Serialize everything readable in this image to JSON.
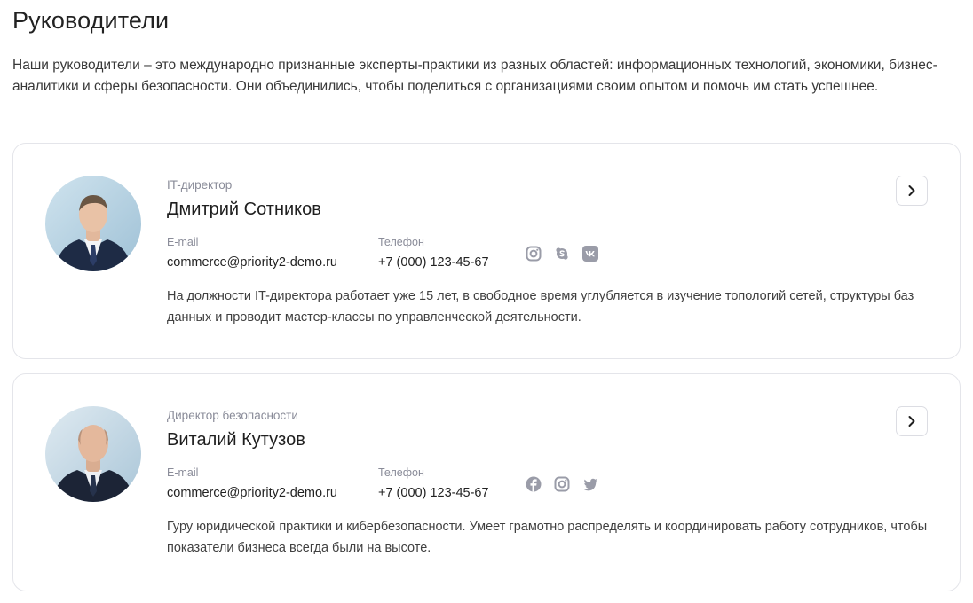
{
  "page": {
    "title": "Руководители",
    "intro": "Наши руководители – это международно признанные эксперты-практики из разных областей: информационных технологий, экономики, бизнес-аналитики и сферы безопасности. Они объединились, чтобы поделиться с организациями своим опытом и помочь им стать успешнее."
  },
  "labels": {
    "email": "E-mail",
    "phone": "Телефон"
  },
  "managers": [
    {
      "role": "IT-директор",
      "name": "Дмитрий Сотников",
      "email": "commerce@priority2-demo.ru",
      "phone": "+7 (000) 123-45-67",
      "socials": [
        "instagram-icon",
        "skype-icon",
        "vk-icon"
      ],
      "description": "На должности IT-директора работает уже 15 лет, в свободное время углубляется в изучение топологий сетей, структуры баз данных и проводит мастер-классы по управленческой деятельности."
    },
    {
      "role": "Директор безопасности",
      "name": "Виталий Кутузов",
      "email": "commerce@priority2-demo.ru",
      "phone": "+7 (000) 123-45-67",
      "socials": [
        "facebook-icon",
        "instagram-icon",
        "twitter-icon"
      ],
      "description": "Гуру юридической практики и кибербезопасности. Умеет грамотно распределять и координировать работу сотрудников, чтобы показатели бизнеса всегда были на высоте."
    }
  ],
  "colors": {
    "icon_gray": "#9a9ca8",
    "border": "#e4e5ea",
    "muted_text": "#8a8c99"
  }
}
